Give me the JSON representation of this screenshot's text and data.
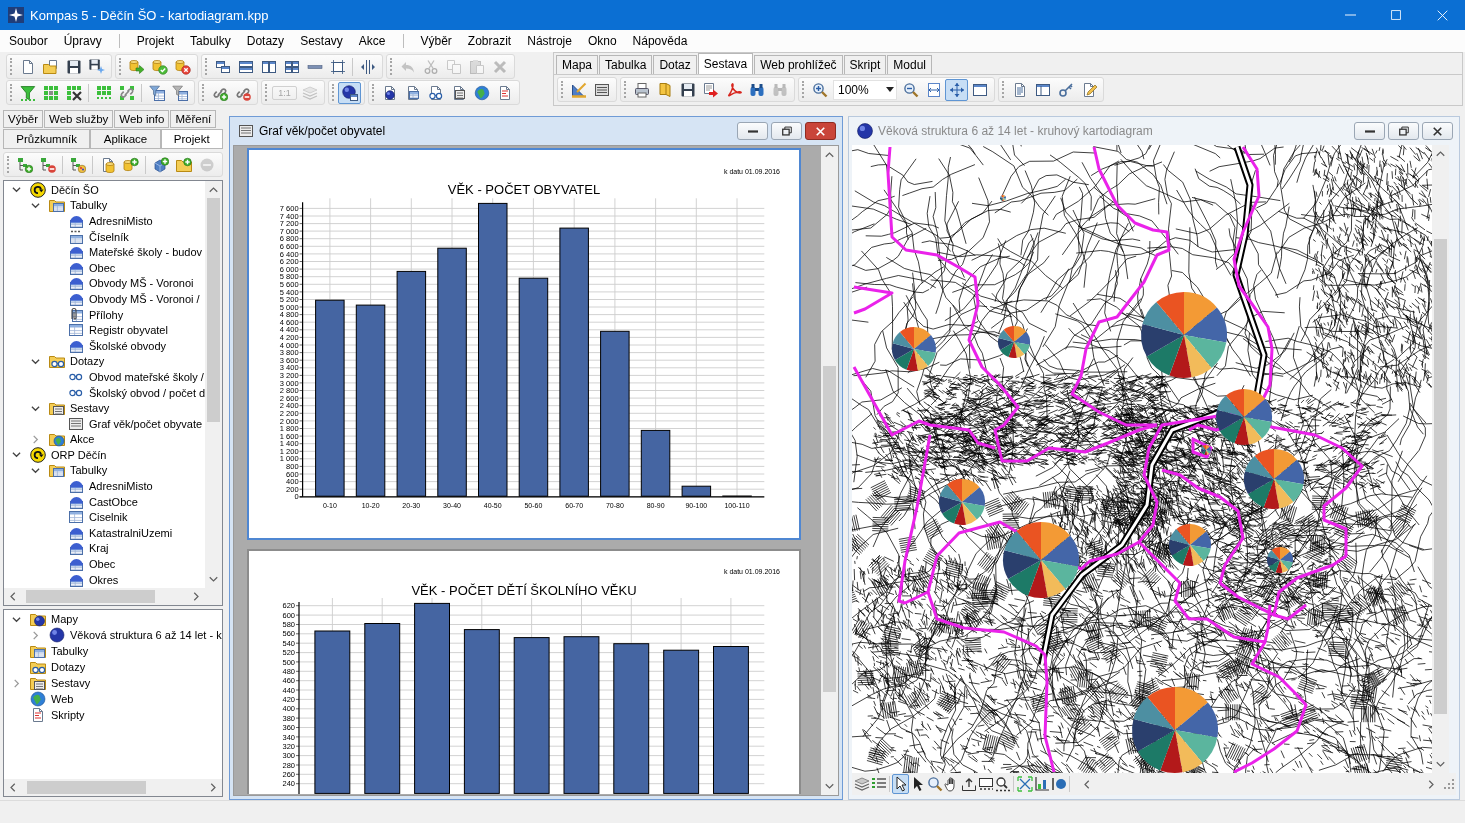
{
  "window": {
    "title": "Kompas 5 - Děčín ŠO - kartodiagram.kpp"
  },
  "menu": {
    "groups": [
      {
        "items": [
          "Soubor",
          "Úpravy"
        ]
      },
      {
        "items": [
          "Projekt",
          "Tabulky",
          "Dotazy",
          "Sestavy",
          "Akce"
        ]
      },
      {
        "items": [
          "Výběr",
          "Zobrazit",
          "Nástroje",
          "Okno",
          "Nápověda"
        ]
      }
    ]
  },
  "toolbars": [
    {
      "blocks": [
        {
          "sections": [
            [
              {
                "kind": "new",
                "disabled": false
              },
              {
                "kind": "open",
                "disabled": false
              },
              {
                "kind": "save",
                "disabled": false
              },
              {
                "kind": "save_as",
                "disabled": false
              }
            ]
          ]
        },
        {
          "sections": [
            [
              {
                "kind": "db_open",
                "disabled": false
              },
              {
                "kind": "db_ok",
                "disabled": false
              },
              {
                "kind": "db_close",
                "disabled": false
              }
            ]
          ]
        },
        {
          "sections": [
            [
              {
                "kind": "cascade",
                "disabled": false
              },
              {
                "kind": "tile_h",
                "disabled": false
              },
              {
                "kind": "tile_v",
                "disabled": false
              },
              {
                "kind": "tile_grid",
                "disabled": false
              },
              {
                "kind": "minimize_all",
                "disabled": false
              },
              {
                "kind": "frame",
                "disabled": false
              }
            ],
            [
              {
                "kind": "split",
                "disabled": false
              }
            ]
          ]
        },
        {
          "sections": [
            [
              {
                "kind": "undo",
                "disabled": true
              },
              {
                "kind": "cut",
                "disabled": true
              },
              {
                "kind": "copy",
                "disabled": true
              },
              {
                "kind": "paste",
                "disabled": true
              },
              {
                "kind": "delete",
                "disabled": true
              }
            ]
          ]
        }
      ]
    },
    {
      "blocks": [
        {
          "sections": [
            [
              {
                "kind": "filter",
                "disabled": false
              },
              {
                "kind": "grid_select",
                "disabled": false
              },
              {
                "kind": "grid_clear",
                "disabled": false
              }
            ],
            [
              {
                "kind": "grid_dots",
                "disabled": false
              },
              {
                "kind": "grid_link",
                "disabled": false
              }
            ],
            [
              {
                "kind": "filter_table",
                "disabled": false
              },
              {
                "kind": "filter_stack",
                "disabled": false
              }
            ]
          ]
        },
        {
          "sections": [
            [
              {
                "kind": "link_add",
                "disabled": false
              },
              {
                "kind": "link_remove",
                "disabled": false
              }
            ]
          ]
        },
        {
          "sections": [
            [
              {
                "kind": "scale",
                "label": "1:1",
                "disabled": true
              },
              {
                "kind": "layers",
                "disabled": true
              }
            ]
          ]
        },
        {
          "sections": [
            [
              {
                "kind": "globe_window",
                "disabled": false,
                "on": true
              }
            ]
          ]
        },
        {
          "sections": [
            [
              {
                "kind": "map_doc",
                "disabled": false
              },
              {
                "kind": "table_doc",
                "disabled": false
              },
              {
                "kind": "query_doc",
                "disabled": false
              },
              {
                "kind": "report_doc",
                "disabled": false
              },
              {
                "kind": "web_doc",
                "disabled": false
              },
              {
                "kind": "script_doc",
                "disabled": false
              }
            ]
          ]
        }
      ]
    }
  ],
  "document_tabs": [
    {
      "label": "Mapa",
      "selected": false
    },
    {
      "label": "Tabulka",
      "selected": false
    },
    {
      "label": "Dotaz",
      "selected": false
    },
    {
      "label": "Sestava",
      "selected": true
    },
    {
      "label": "Web prohlížeč",
      "selected": false
    },
    {
      "label": "Skript",
      "selected": false
    },
    {
      "label": "Modul",
      "selected": false
    }
  ],
  "document_toolbar": {
    "blocks": [
      {
        "sections": [
          [
            {
              "kind": "measure",
              "disabled": false
            },
            {
              "kind": "table_view",
              "disabled": false
            }
          ]
        ]
      },
      {
        "sections": [
          [
            {
              "kind": "print",
              "disabled": false
            },
            {
              "kind": "book",
              "disabled": false
            },
            {
              "kind": "save",
              "disabled": false
            },
            {
              "kind": "export",
              "disabled": false
            },
            {
              "kind": "pdf",
              "disabled": false
            },
            {
              "kind": "find",
              "disabled": false
            },
            {
              "kind": "find_next",
              "disabled": true
            }
          ]
        ]
      },
      {
        "sections": [
          [
            {
              "kind": "zoom_in",
              "disabled": false,
              "on": false
            },
            {
              "kind": "zoom_combo",
              "value": "100%",
              "disabled": false,
              "on": false
            },
            {
              "kind": "zoom_out",
              "disabled": false,
              "on": false
            },
            {
              "kind": "fit_width",
              "disabled": false,
              "on": false
            },
            {
              "kind": "fit_page",
              "disabled": false,
              "on": true
            },
            {
              "kind": "page_view",
              "disabled": false,
              "on": false
            }
          ]
        ]
      },
      {
        "sections": [
          [
            {
              "kind": "outline",
              "disabled": false
            },
            {
              "kind": "panes",
              "disabled": false
            },
            {
              "kind": "properties",
              "disabled": false
            },
            {
              "kind": "edit",
              "disabled": false
            }
          ]
        ]
      }
    ]
  },
  "side_panel": {
    "tab_rows": [
      {
        "tabs": [
          {
            "label": "Výběr",
            "selected": false
          },
          {
            "label": "Web služby",
            "selected": false
          },
          {
            "label": "Web info",
            "selected": false
          },
          {
            "label": "Měření",
            "selected": false
          }
        ]
      },
      {
        "tabs": [
          {
            "label": "Průzkumník",
            "selected": false
          },
          {
            "label": "Aplikace",
            "selected": false
          },
          {
            "label": "Projekt",
            "selected": true
          }
        ]
      }
    ],
    "toolbar": {
      "sections": [
        [
          {
            "kind": "tree_add",
            "disabled": false
          },
          {
            "kind": "tree_remove",
            "disabled": false
          }
        ],
        [
          {
            "kind": "tree_style",
            "disabled": false
          }
        ],
        [
          {
            "kind": "doc_db",
            "disabled": false
          },
          {
            "kind": "db_add",
            "disabled": false
          }
        ],
        [
          {
            "kind": "cube_add",
            "disabled": false
          },
          {
            "kind": "folder_add",
            "disabled": false
          },
          {
            "kind": "remove",
            "disabled": true
          }
        ]
      ]
    },
    "project_tree": [
      {
        "label": "Děčín ŠO",
        "kind": "project",
        "expanded": true,
        "children": [
          {
            "label": "Tabulky",
            "kind": "tables",
            "expanded": true,
            "children": [
              {
                "label": "AdresniMisto",
                "kind": "layer"
              },
              {
                "label": "Číselník",
                "kind": "codelist"
              },
              {
                "label": "Mateřské školy - budov",
                "kind": "layer"
              },
              {
                "label": "Obec",
                "kind": "layer"
              },
              {
                "label": "Obvody MŠ - Voronoi",
                "kind": "layer"
              },
              {
                "label": "Obvody MŠ - Voronoi /",
                "kind": "layer"
              },
              {
                "label": "Přílohy",
                "kind": "attachments"
              },
              {
                "label": "Registr obyvatel",
                "kind": "table"
              },
              {
                "label": "Školské obvody",
                "kind": "layer"
              }
            ]
          },
          {
            "label": "Dotazy",
            "kind": "queries",
            "expanded": true,
            "children": [
              {
                "label": "Obvod mateřské školy /",
                "kind": "query"
              },
              {
                "label": "Školský obvod / počet d",
                "kind": "query"
              }
            ]
          },
          {
            "label": "Sestavy",
            "kind": "reports",
            "expanded": true,
            "children": [
              {
                "label": "Graf věk/počet obyvate",
                "kind": "report"
              }
            ]
          },
          {
            "label": "Akce",
            "kind": "actions",
            "expanded": false
          }
        ]
      },
      {
        "label": "ORP Děčín",
        "kind": "project",
        "expanded": true,
        "children": [
          {
            "label": "Tabulky",
            "kind": "tables",
            "expanded": true,
            "children": [
              {
                "label": "AdresniMisto",
                "kind": "layer"
              },
              {
                "label": "CastObce",
                "kind": "layer"
              },
              {
                "label": "Ciselnik",
                "kind": "table"
              },
              {
                "label": "KatastralniUzemi",
                "kind": "layer"
              },
              {
                "label": "Kraj",
                "kind": "layer"
              },
              {
                "label": "Obec",
                "kind": "layer"
              },
              {
                "label": "Okres",
                "kind": "layer"
              }
            ]
          }
        ]
      }
    ],
    "app_tree": [
      {
        "label": "Mapy",
        "kind": "maps",
        "expanded": true,
        "children": [
          {
            "label": "Věková struktura 6 až 14 let - k",
            "kind": "map",
            "expanded": false
          }
        ]
      },
      {
        "label": "Tabulky",
        "kind": "tables"
      },
      {
        "label": "Dotazy",
        "kind": "queries"
      },
      {
        "label": "Sestavy",
        "kind": "reports",
        "expanded": false
      },
      {
        "label": "Web",
        "kind": "web"
      },
      {
        "label": "Skripty",
        "kind": "scripts"
      }
    ]
  },
  "chart_window": {
    "title": "Graf věk/počet obyvatel",
    "active": true,
    "pages": [
      {
        "selected": true,
        "date_note": "k datu 01.09.2016",
        "chart_data": {
          "type": "bar",
          "title": "VĚK - POČET OBYVATEL",
          "grid": true,
          "categories": [
            "0-10",
            "10-20",
            "20-30",
            "30-40",
            "40-50",
            "50-60",
            "60-70",
            "70-80",
            "80-90",
            "90-100",
            "100-110"
          ],
          "values": [
            5180,
            5050,
            5940,
            6550,
            7730,
            5760,
            7080,
            4360,
            1750,
            280,
            20
          ],
          "ylim": [
            0,
            7760
          ],
          "yticks": [
            0,
            200,
            400,
            600,
            800,
            {
              "value": 1000,
              "label": "1 000"
            },
            {
              "value": 1200,
              "label": "1 200"
            },
            {
              "value": 1400,
              "label": "1 400"
            },
            {
              "value": 1600,
              "label": "1 600"
            },
            {
              "value": 1800,
              "label": "1 800"
            },
            {
              "value": 2000,
              "label": "2 000"
            },
            {
              "value": 2200,
              "label": "2 200"
            },
            {
              "value": 2400,
              "label": "2 400"
            },
            {
              "value": 2600,
              "label": "2 600"
            },
            {
              "value": 2800,
              "label": "2 800"
            },
            {
              "value": 3000,
              "label": "3 000"
            },
            {
              "value": 3200,
              "label": "3 200"
            },
            {
              "value": 3400,
              "label": "3 400"
            },
            {
              "value": 3600,
              "label": "3 600"
            },
            {
              "value": 3800,
              "label": "3 800"
            },
            {
              "value": 4000,
              "label": "4 000"
            },
            {
              "value": 4200,
              "label": "4 200"
            },
            {
              "value": 4400,
              "label": "4 400"
            },
            {
              "value": 4600,
              "label": "4 600"
            },
            {
              "value": 4800,
              "label": "4 800"
            },
            {
              "value": 5000,
              "label": "5 000"
            },
            {
              "value": 5200,
              "label": "5 200"
            },
            {
              "value": 5400,
              "label": "5 400"
            },
            {
              "value": 5600,
              "label": "5 600"
            },
            {
              "value": 5800,
              "label": "5 800"
            },
            {
              "value": 6000,
              "label": "6 000"
            },
            {
              "value": 6200,
              "label": "6 200"
            },
            {
              "value": 6400,
              "label": "6 400"
            },
            {
              "value": 6600,
              "label": "6 600"
            },
            {
              "value": 6800,
              "label": "6 800"
            },
            {
              "value": 7000,
              "label": "7 000"
            },
            {
              "value": 7200,
              "label": "7 200"
            },
            {
              "value": 7400,
              "label": "7 400"
            },
            {
              "value": 7600,
              "label": "7 600"
            }
          ]
        }
      },
      {
        "selected": false,
        "date_note": "k datu 01.09.2016",
        "chart_data": {
          "type": "bar",
          "title": "VĚK - POČET DĚTÍ ŠKOLNÍHO VĚKU",
          "grid": true,
          "values": [
            566,
            582,
            625,
            569,
            552,
            554,
            539,
            525,
            533
          ],
          "ylim": [
            218,
            628
          ],
          "yticks": [
            240,
            260,
            280,
            300,
            320,
            340,
            360,
            380,
            400,
            420,
            440,
            460,
            480,
            500,
            520,
            540,
            560,
            580,
            600,
            620
          ]
        }
      }
    ]
  },
  "map_window": {
    "title": "Věková struktura 6 až 14 let - kruhový kartodiagram",
    "active": false,
    "toolbar": {
      "sections": [
        [
          {
            "kind": "layers",
            "disabled": false
          },
          {
            "kind": "legend",
            "disabled": false
          }
        ],
        [
          {
            "kind": "select",
            "disabled": false,
            "on": true
          },
          {
            "kind": "pointer",
            "disabled": false,
            "on": false
          },
          {
            "kind": "zoom",
            "disabled": false,
            "on": false
          },
          {
            "kind": "pan",
            "disabled": false,
            "on": false
          },
          {
            "kind": "tray_up",
            "disabled": false,
            "on": false
          },
          {
            "kind": "tray_dots",
            "disabled": false,
            "on": false
          },
          {
            "kind": "mag_dots",
            "disabled": false,
            "on": false
          }
        ],
        [
          {
            "kind": "full_extent",
            "disabled": false
          },
          {
            "kind": "chart_tool",
            "disabled": false
          },
          {
            "kind": "dot_layer",
            "disabled": false
          }
        ]
      ]
    }
  }
}
